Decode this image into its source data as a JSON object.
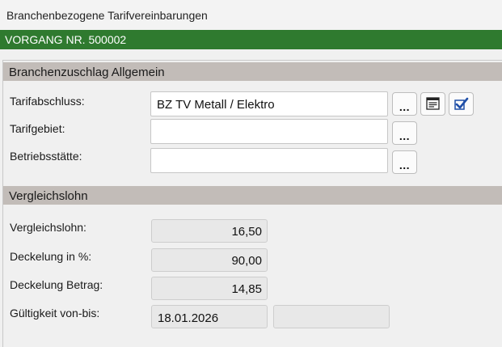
{
  "window": {
    "title": "Branchenbezogene Tarifvereinbarungen"
  },
  "vorgang": {
    "label": "VORGANG NR. 500002"
  },
  "section_allgemein": {
    "title": "Branchenzuschlag Allgemein",
    "fields": {
      "tarifabschluss": {
        "label": "Tarifabschluss:",
        "value": "BZ TV Metall / Elektro"
      },
      "tarifgebiet": {
        "label": "Tarifgebiet:",
        "value": ""
      },
      "betriebsstaette": {
        "label": "Betriebsstätte:",
        "value": ""
      }
    },
    "buttons": {
      "browse": "...",
      "details_icon": "document-details-icon",
      "check_icon": "checkmark-icon"
    }
  },
  "section_vergleichslohn": {
    "title": "Vergleichslohn",
    "fields": {
      "vergleichslohn": {
        "label": "Vergleichslohn:",
        "value": "16,50"
      },
      "deckelung_prozent": {
        "label": "Deckelung in %:",
        "value": "90,00"
      },
      "deckelung_betrag": {
        "label": "Deckelung Betrag:",
        "value": "14,85"
      },
      "gueltigkeit": {
        "label": "Gültigkeit von-bis:",
        "von": "18.01.2026",
        "bis": ""
      }
    }
  },
  "colors": {
    "header_green": "#2f7a2f",
    "section_gray": "#c2bcb8",
    "check_blue": "#1f4fa8"
  }
}
